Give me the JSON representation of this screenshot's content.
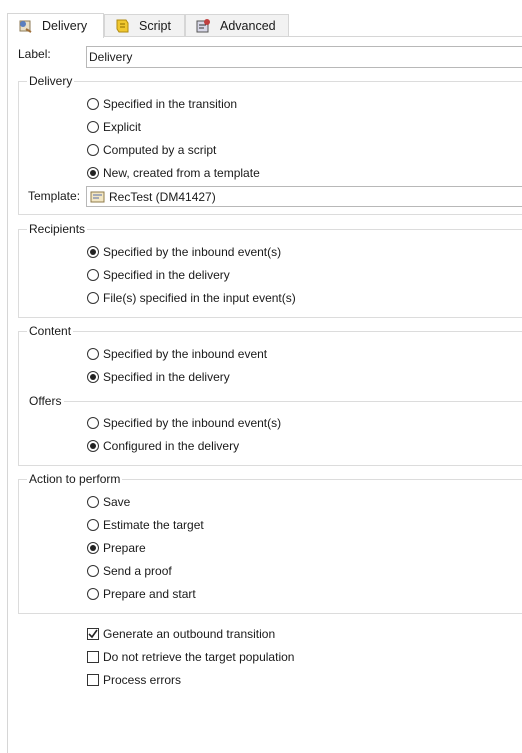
{
  "tabs": [
    {
      "label": "Delivery",
      "icon": "delivery-icon"
    },
    {
      "label": "Script",
      "icon": "script-icon"
    },
    {
      "label": "Advanced",
      "icon": "advanced-icon"
    }
  ],
  "label_field": {
    "label": "Label:",
    "value": "Delivery"
  },
  "delivery": {
    "title": "Delivery",
    "options": [
      "Specified in the transition",
      "Explicit",
      "Computed by a script",
      "New, created from a template"
    ],
    "selected": 3,
    "template_label": "Template:",
    "template_value": "RecTest (DM41427)"
  },
  "recipients": {
    "title": "Recipients",
    "options": [
      "Specified by the inbound event(s)",
      "Specified in the delivery",
      "File(s) specified in the input event(s)"
    ],
    "selected": 0
  },
  "content": {
    "title": "Content",
    "options": [
      "Specified by the inbound event",
      "Specified in the delivery"
    ],
    "selected": 1
  },
  "offers": {
    "title": "Offers",
    "options": [
      "Specified by the inbound event(s)",
      "Configured in the delivery"
    ],
    "selected": 1
  },
  "action": {
    "title": "Action to perform",
    "options": [
      "Save",
      "Estimate the target",
      "Prepare",
      "Send a proof",
      "Prepare and start"
    ],
    "selected": 2
  },
  "checkboxes": [
    {
      "label": "Generate an outbound transition",
      "checked": true
    },
    {
      "label": "Do not retrieve the target population",
      "checked": false
    },
    {
      "label": "Process errors",
      "checked": false
    }
  ]
}
